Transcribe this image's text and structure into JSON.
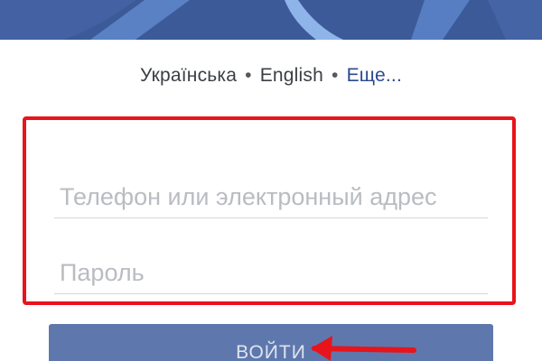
{
  "header": {
    "background_color": "#3c5a98"
  },
  "languages": {
    "items": [
      {
        "label": "Українська"
      },
      {
        "label": "English"
      }
    ],
    "separator": "•",
    "more_label": "Еще..."
  },
  "login_form": {
    "phone_placeholder": "Телефон или электронный адрес",
    "phone_value": "",
    "password_placeholder": "Пароль",
    "password_value": "",
    "submit_label": "ВОЙТИ"
  },
  "annotations": {
    "highlight_color": "#e8141c",
    "arrow_color": "#e8141c",
    "arrow_icon": "left-arrow-icon"
  }
}
